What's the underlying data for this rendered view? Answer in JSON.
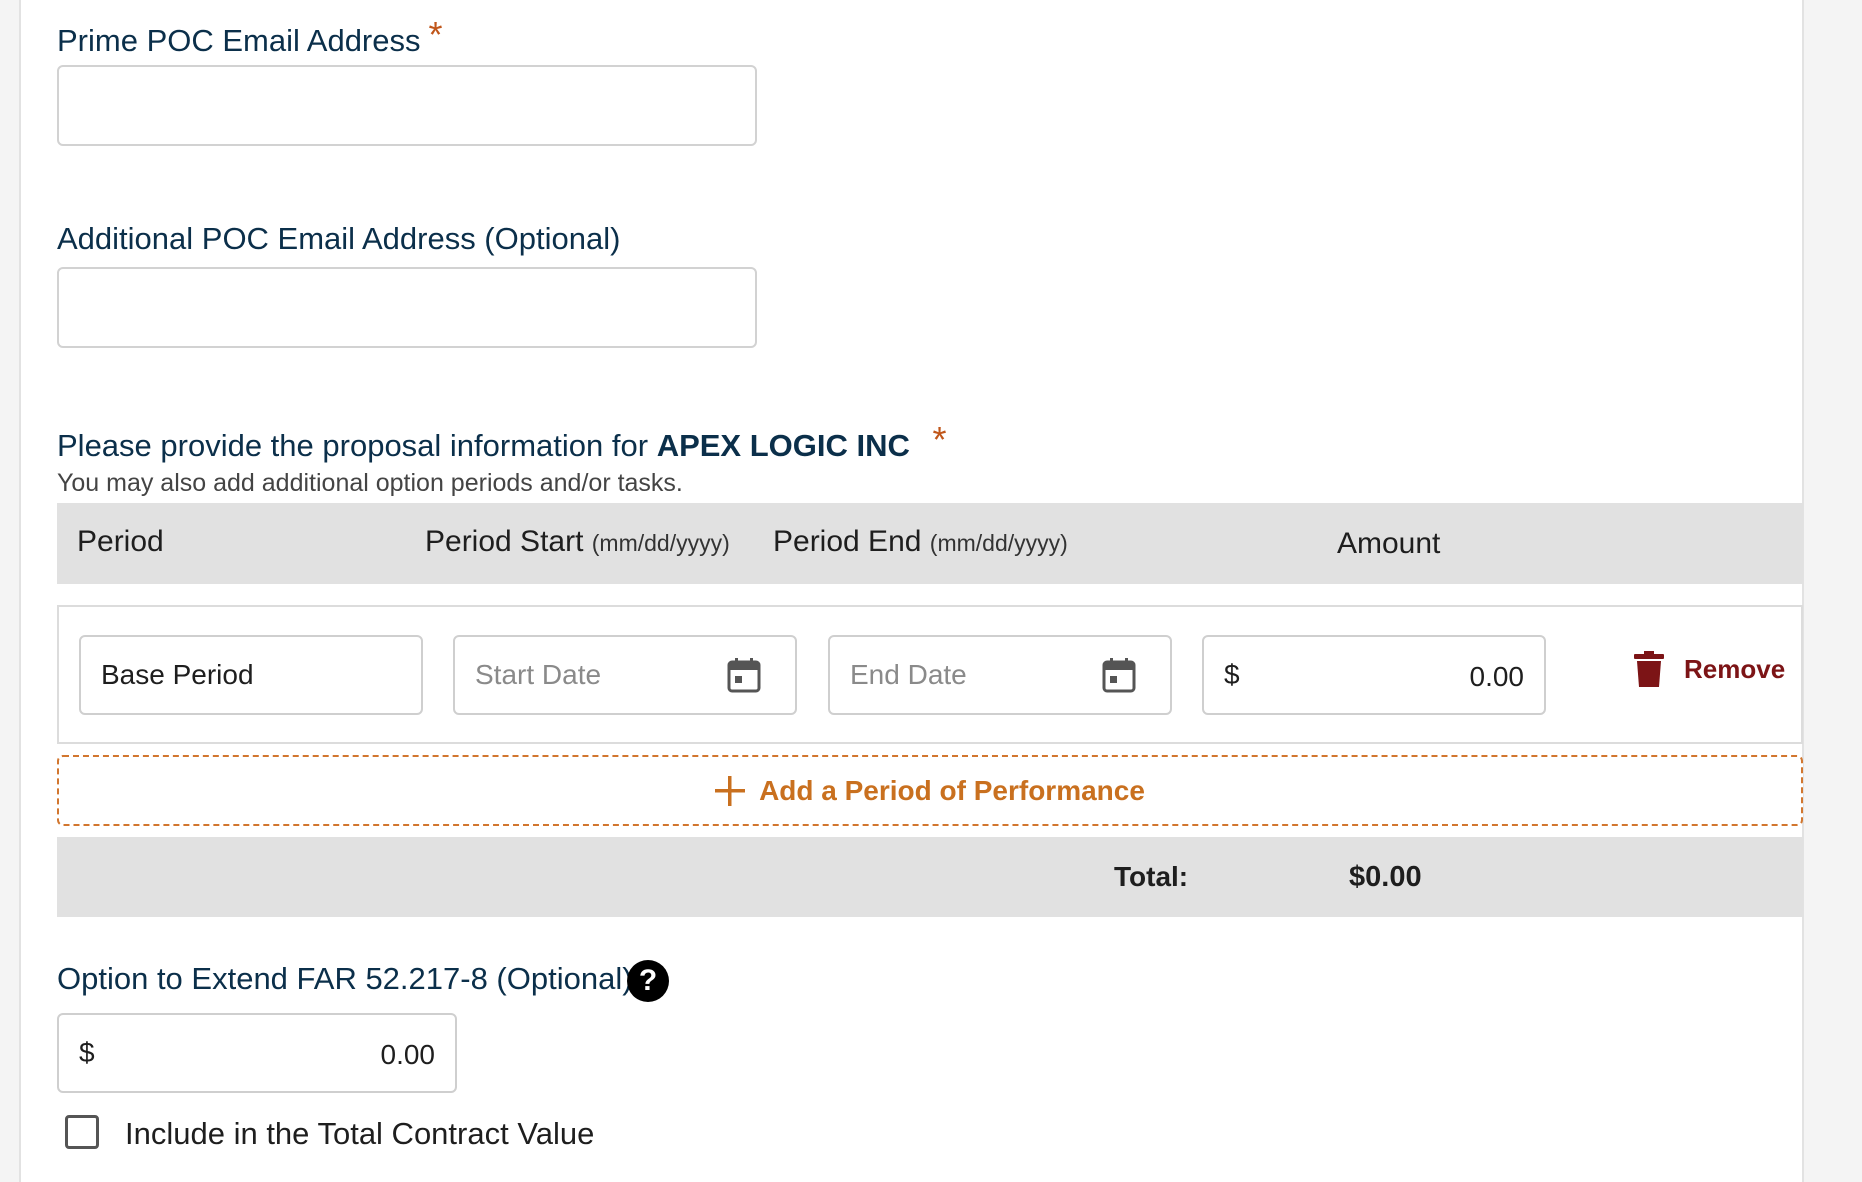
{
  "prime_poc": {
    "label": "Prime POC Email Address",
    "required_mark": "*",
    "value": ""
  },
  "additional_poc": {
    "label": "Additional POC Email Address (Optional)",
    "value": ""
  },
  "proposal": {
    "prompt_prefix": "Please provide the proposal information for",
    "company": "APEX LOGIC INC",
    "required_mark": "*",
    "subtext": "You may also add additional option periods and/or tasks."
  },
  "table": {
    "headers": {
      "period": "Period",
      "start": "Period Start",
      "start_fmt": "(mm/dd/yyyy)",
      "end": "Period End",
      "end_fmt": "(mm/dd/yyyy)",
      "amount": "Amount"
    },
    "rows": [
      {
        "period_name": "Base Period",
        "start_placeholder": "Start Date",
        "end_placeholder": "End Date",
        "currency_symbol": "$",
        "amount": "0.00",
        "remove_label": "Remove",
        "remove_icon": "trash-icon"
      }
    ],
    "add_button_label": "Add a Period of Performance",
    "add_icon": "plus-icon",
    "total_label": "Total:",
    "total_value": "$0.00"
  },
  "option_extend": {
    "label": "Option to Extend FAR 52.217-8 (Optional)",
    "help_icon": "question-circle-icon",
    "help_glyph": "?",
    "currency_symbol": "$",
    "amount": "0.00",
    "checkbox_label": "Include in the Total Contract Value",
    "checkbox_checked": false
  },
  "colors": {
    "label": "#0b2f4a",
    "required": "#c0561a",
    "add_accent": "#c9701f",
    "remove": "#7c1416",
    "header_bg": "#e1e1e1"
  }
}
